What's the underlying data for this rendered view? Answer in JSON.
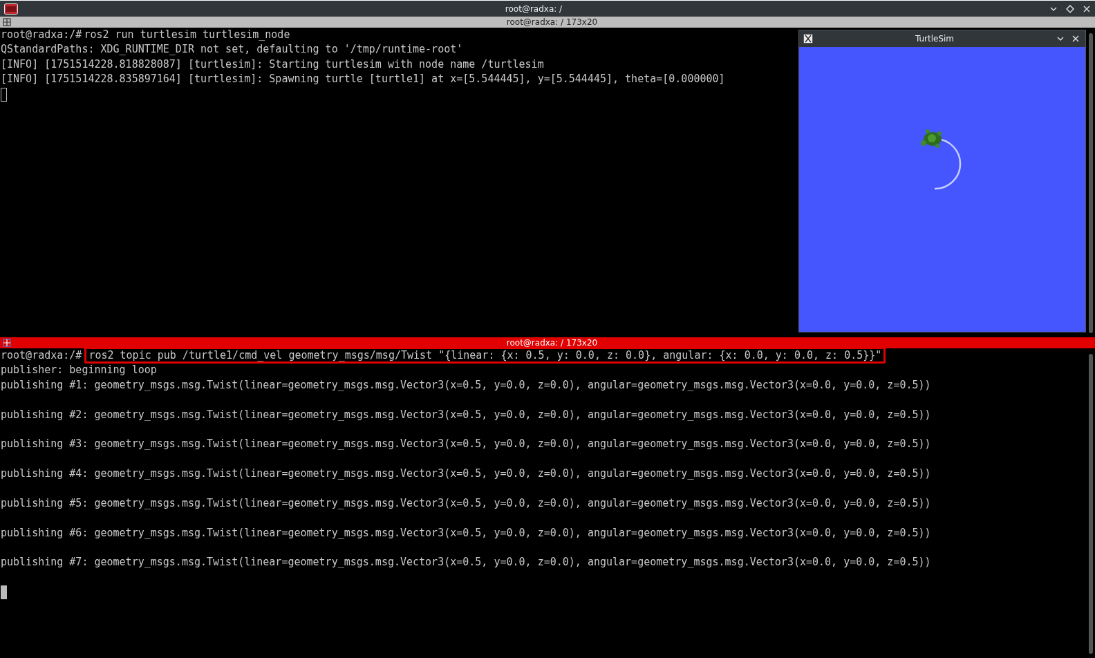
{
  "window": {
    "title": "root@radxa: /"
  },
  "panes": [
    {
      "header": "root@radxa: / 173x20",
      "active": false,
      "lines": [
        {
          "kind": "command",
          "prompt": "root@radxa:/#",
          "text": "ros2 run turtlesim turtlesim_node",
          "highlighted": false
        },
        {
          "kind": "output",
          "text": "QStandardPaths: XDG_RUNTIME_DIR not set, defaulting to '/tmp/runtime-root'"
        },
        {
          "kind": "output",
          "text": "[INFO] [1751514228.818828087] [turtlesim]: Starting turtlesim with node name /turtlesim"
        },
        {
          "kind": "output",
          "text": "[INFO] [1751514228.835897164] [turtlesim]: Spawning turtle [turtle1] at x=[5.544445], y=[5.544445], theta=[0.000000]"
        }
      ]
    },
    {
      "header": "root@radxa: / 173x20",
      "active": true,
      "lines": [
        {
          "kind": "command",
          "prompt": "root@radxa:/#",
          "text": "ros2 topic pub /turtle1/cmd_vel geometry_msgs/msg/Twist \"{linear: {x: 0.5, y: 0.0, z: 0.0}, angular: {x: 0.0, y: 0.0, z: 0.5}}\"",
          "highlighted": true
        },
        {
          "kind": "output",
          "text": "publisher: beginning loop"
        },
        {
          "kind": "output",
          "text": "publishing #1: geometry_msgs.msg.Twist(linear=geometry_msgs.msg.Vector3(x=0.5, y=0.0, z=0.0), angular=geometry_msgs.msg.Vector3(x=0.0, y=0.0, z=0.5))"
        },
        {
          "kind": "blank"
        },
        {
          "kind": "output",
          "text": "publishing #2: geometry_msgs.msg.Twist(linear=geometry_msgs.msg.Vector3(x=0.5, y=0.0, z=0.0), angular=geometry_msgs.msg.Vector3(x=0.0, y=0.0, z=0.5))"
        },
        {
          "kind": "blank"
        },
        {
          "kind": "output",
          "text": "publishing #3: geometry_msgs.msg.Twist(linear=geometry_msgs.msg.Vector3(x=0.5, y=0.0, z=0.0), angular=geometry_msgs.msg.Vector3(x=0.0, y=0.0, z=0.5))"
        },
        {
          "kind": "blank"
        },
        {
          "kind": "output",
          "text": "publishing #4: geometry_msgs.msg.Twist(linear=geometry_msgs.msg.Vector3(x=0.5, y=0.0, z=0.0), angular=geometry_msgs.msg.Vector3(x=0.0, y=0.0, z=0.5))"
        },
        {
          "kind": "blank"
        },
        {
          "kind": "output",
          "text": "publishing #5: geometry_msgs.msg.Twist(linear=geometry_msgs.msg.Vector3(x=0.5, y=0.0, z=0.0), angular=geometry_msgs.msg.Vector3(x=0.0, y=0.0, z=0.5))"
        },
        {
          "kind": "blank"
        },
        {
          "kind": "output",
          "text": "publishing #6: geometry_msgs.msg.Twist(linear=geometry_msgs.msg.Vector3(x=0.5, y=0.0, z=0.0), angular=geometry_msgs.msg.Vector3(x=0.0, y=0.0, z=0.5))"
        },
        {
          "kind": "blank"
        },
        {
          "kind": "output",
          "text": "publishing #7: geometry_msgs.msg.Twist(linear=geometry_msgs.msg.Vector3(x=0.5, y=0.0, z=0.0), angular=geometry_msgs.msg.Vector3(x=0.0, y=0.0, z=0.5))"
        },
        {
          "kind": "blank"
        }
      ]
    }
  ],
  "turtlesim": {
    "title": "TurtleSim"
  }
}
